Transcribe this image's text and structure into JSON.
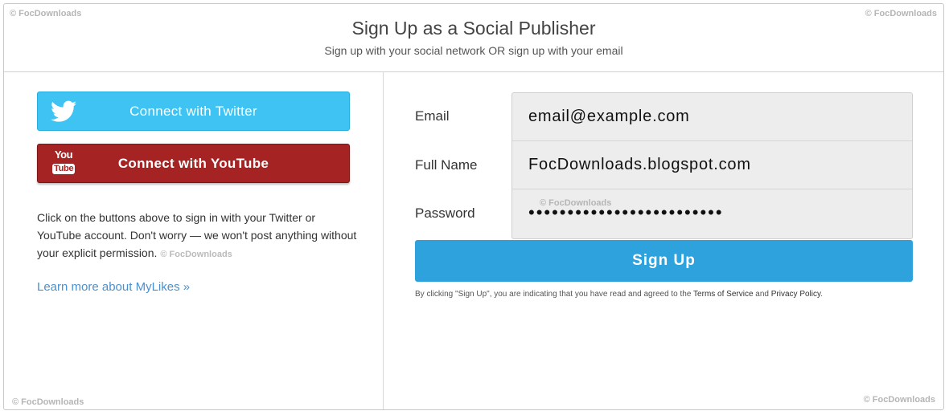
{
  "header": {
    "title": "Sign Up as a Social Publisher",
    "subtitle": "Sign up with your social network OR sign up with your email"
  },
  "watermark": "© FocDownloads",
  "social": {
    "twitter_label": "Connect with Twitter",
    "youtube_label": "Connect with YouTube",
    "youtube_icon_top": "You",
    "youtube_icon_bottom": "Tube",
    "info_text": "Click on the buttons above to sign in with your Twitter or YouTube account. Don't worry — we won't post anything without your explicit permission.",
    "learn_more": "Learn more about MyLikes »"
  },
  "form": {
    "email_label": "Email",
    "email_value": "email@example.com",
    "name_label": "Full Name",
    "name_value": "FocDownloads.blogspot.com",
    "password_label": "Password",
    "password_value": "•••••••••••••••••••••••••",
    "signup_label": "Sign Up",
    "terms_prefix": "By clicking \"Sign Up\", you are indicating that you have read and agreed to the",
    "terms_link": "Terms of Service",
    "terms_and": "and",
    "privacy_link": "Privacy Policy",
    "terms_suffix": "."
  },
  "colors": {
    "twitter": "#3ec3f2",
    "youtube": "#a52323",
    "signup": "#2ea2dc",
    "link": "#4a90d0"
  },
  "icons": [
    "twitter-bird-icon",
    "youtube-logo-icon"
  ]
}
